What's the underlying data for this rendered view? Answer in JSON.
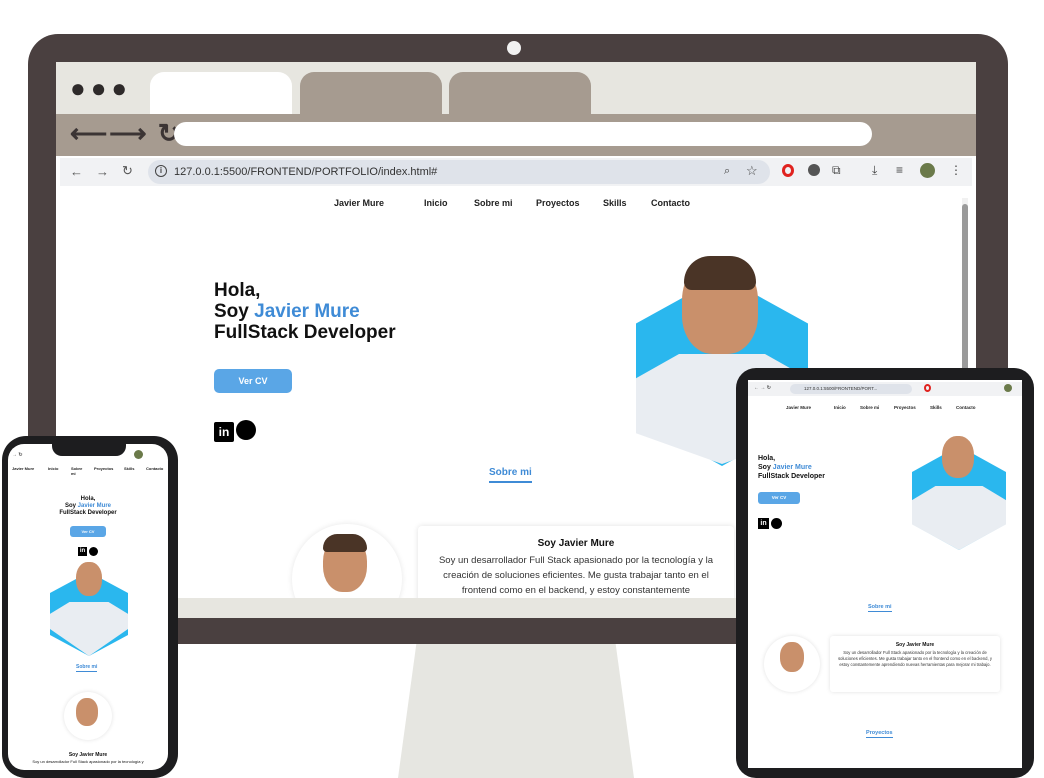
{
  "browser": {
    "url": "127.0.0.1:5500/FRONTEND/PORTFOLIO/index.html#",
    "nav_icons": [
      "back-icon",
      "forward-icon",
      "reload-icon",
      "info-icon",
      "zoom-icon",
      "star-icon",
      "opera-icon",
      "extension-icon",
      "puzzle-icon",
      "download-icon",
      "playlist-icon",
      "profile-avatar",
      "menu-icon"
    ]
  },
  "site": {
    "nav": {
      "brand": "Javier Mure",
      "items": [
        "Inicio",
        "Sobre mi",
        "Proyectos",
        "Skills",
        "Contacto"
      ]
    },
    "hero": {
      "line1": "Hola,",
      "line2_prefix": "Soy",
      "line2_name": "Javier Mure",
      "line3": "FullStack Developer",
      "cv_button": "Ver CV"
    },
    "about": {
      "section_title": "Sobre mi",
      "card_title": "Soy Javier Mure",
      "card_text_desktop": "Soy un desarrollador Full Stack apasionado por la tecnología y la creación de soluciones eficientes. Me gusta trabajar tanto en el frontend como en el backend, y estoy constantemente",
      "card_text_tablet": "Soy un desarrollador Full Stack apasionado por la tecnología y la creación de soluciones eficientes. Me gusta trabajar tanto en el frontend como en el backend, y estoy constantemente aprendiendo nuevas herramientas para mejorar mi trabajo.",
      "card_text_phone": "Soy un desarrollador Full Stack apasionado por la tecnología y"
    },
    "projects": {
      "section_title": "Proyectos"
    }
  },
  "tablet": {
    "url": "127.0.0.1:5500/FRONTEND/PORT..."
  },
  "colors": {
    "accent": "#3f8bd6",
    "button": "#5aa6e6",
    "hex": "#2ab7ee",
    "frame": "#4a4040",
    "tab": "#a69b90"
  }
}
